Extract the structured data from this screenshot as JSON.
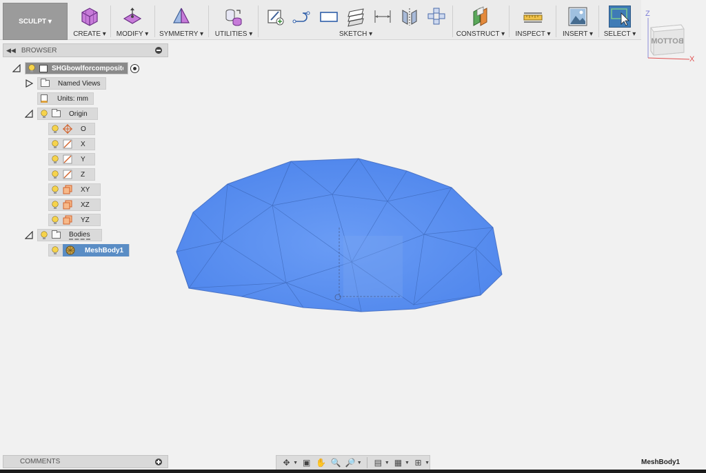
{
  "toolbar": {
    "workspace": "SCULPT ▾",
    "groups": {
      "create": "CREATE ▾",
      "modify": "MODIFY ▾",
      "symmetry": "SYMMETRY ▾",
      "utilities": "UTILITIES ▾",
      "sketch": "SKETCH ▾",
      "construct": "CONSTRUCT ▾",
      "inspect": "INSPECT ▾",
      "insert": "INSERT ▾",
      "select": "SELECT ▾"
    }
  },
  "viewcube": {
    "face_label": "BOTTOM",
    "axis_z": "Z",
    "axis_x": "X"
  },
  "browser": {
    "title": "BROWSER",
    "root": "SHGbowlforcomposite...",
    "named_views": "Named Views",
    "units": "Units: mm",
    "origin": "Origin",
    "origin_items": [
      "O",
      "X",
      "Y",
      "Z",
      "XY",
      "XZ",
      "YZ"
    ],
    "bodies": "Bodies",
    "mesh_body": "MeshBody1"
  },
  "comments": {
    "title": "COMMENTS"
  },
  "status": {
    "selection": "MeshBody1"
  },
  "colors": {
    "mesh": "#5b8ff0",
    "selected": "#5a8dc5",
    "accent_select": "#3f7bb6"
  }
}
